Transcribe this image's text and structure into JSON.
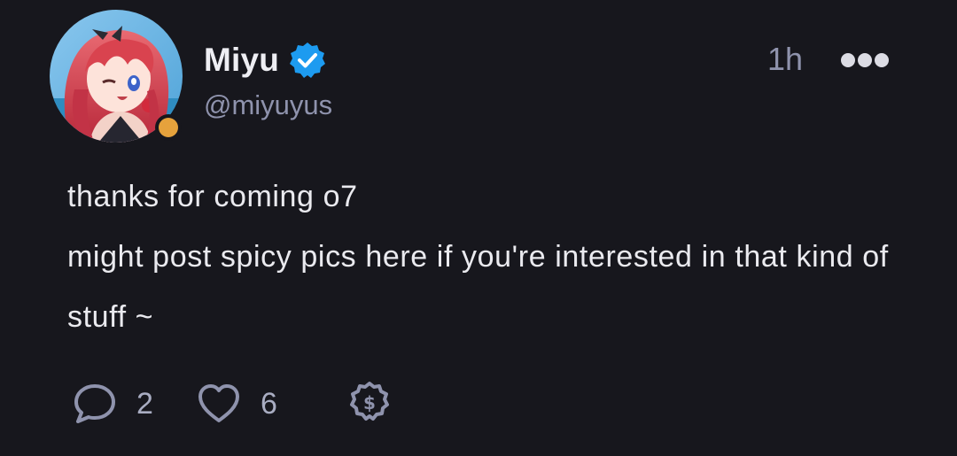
{
  "post": {
    "author": {
      "display_name": "Miyu",
      "handle": "@miyuyus",
      "verified": true,
      "status_color": "#e6a23c"
    },
    "timestamp": "1h",
    "content_lines": [
      "thanks for coming o7",
      "might post spicy pics here if you're interested in that kind of stuff ~"
    ],
    "actions": {
      "reply_count": "2",
      "like_count": "6"
    },
    "icons": {
      "more": "ellipsis-icon",
      "reply": "speech-bubble-icon",
      "like": "heart-icon",
      "tip": "dollar-badge-icon",
      "verified": "verified-badge-icon"
    },
    "colors": {
      "background": "#17171d",
      "accent": "#1d9bf0",
      "muted": "#8f93ad"
    }
  }
}
